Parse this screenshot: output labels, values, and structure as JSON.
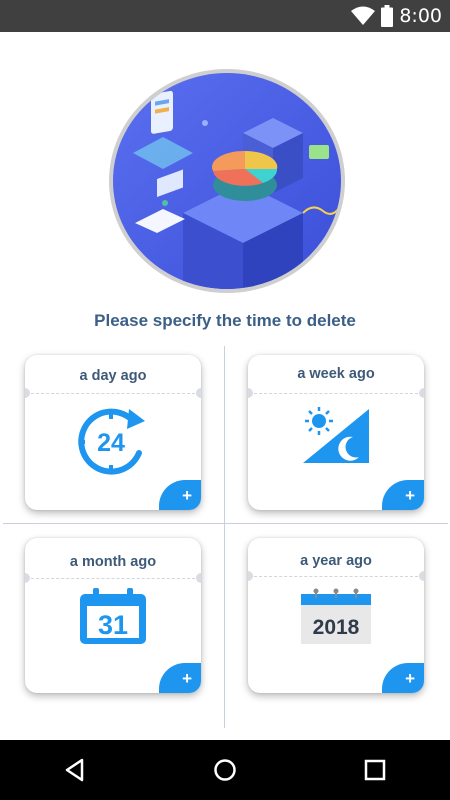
{
  "status_bar": {
    "time": "8:00",
    "icons": [
      "wifi-icon",
      "battery-icon"
    ]
  },
  "prompt": "Please specify the time to delete",
  "cards": [
    {
      "title": "a day ago",
      "icon": "24-hour-clock-icon",
      "icon_text": "24"
    },
    {
      "title": "a week ago",
      "icon": "day-night-icon"
    },
    {
      "title": "a month ago",
      "icon": "calendar-icon",
      "icon_text": "31"
    },
    {
      "title": "a year ago",
      "icon": "year-calendar-icon",
      "icon_text": "2018"
    }
  ],
  "add_label": "+",
  "colors": {
    "accent": "#1e96f0",
    "title_text": "#3b5f86",
    "status_bar": "#404040",
    "nav_bar": "#000000"
  },
  "nav": [
    "back-icon",
    "home-icon",
    "recents-icon"
  ]
}
